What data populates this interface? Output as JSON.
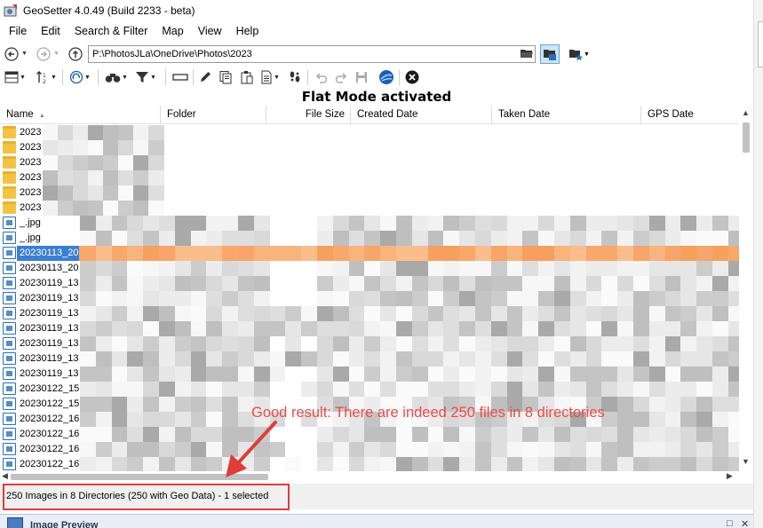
{
  "window": {
    "title": "GeoSetter 4.0.49 (Build 2233 - beta)"
  },
  "menu": [
    "File",
    "Edit",
    "Search & Filter",
    "Map",
    "View",
    "Help"
  ],
  "address": {
    "path": "P:\\PhotosJLa\\OneDrive\\Photos\\2023"
  },
  "banner": "Flat Mode activated",
  "columns": [
    {
      "label": "Name",
      "sort": "ascending"
    },
    {
      "label": "Folder"
    },
    {
      "label": "File Size"
    },
    {
      "label": "Created Date"
    },
    {
      "label": "Taken Date"
    },
    {
      "label": "GPS Date"
    }
  ],
  "rows": [
    {
      "type": "folder",
      "name": "2023"
    },
    {
      "type": "folder",
      "name": "2023"
    },
    {
      "type": "folder",
      "name": "2023"
    },
    {
      "type": "folder",
      "name": "2023"
    },
    {
      "type": "folder",
      "name": "2023"
    },
    {
      "type": "folder",
      "name": "2023"
    },
    {
      "type": "file",
      "name": "_.jpg"
    },
    {
      "type": "file",
      "name": "_.jpg"
    },
    {
      "type": "file",
      "name": "20230113_20",
      "selected": true
    },
    {
      "type": "file",
      "name": "20230113_20"
    },
    {
      "type": "file",
      "name": "20230119_13"
    },
    {
      "type": "file",
      "name": "20230119_13"
    },
    {
      "type": "file",
      "name": "20230119_13"
    },
    {
      "type": "file",
      "name": "20230119_13"
    },
    {
      "type": "file",
      "name": "20230119_13"
    },
    {
      "type": "file",
      "name": "20230119_13"
    },
    {
      "type": "file",
      "name": "20230119_13"
    },
    {
      "type": "file",
      "name": "20230122_15"
    },
    {
      "type": "file",
      "name": "20230122_15"
    },
    {
      "type": "file",
      "name": "20230122_16"
    },
    {
      "type": "file",
      "name": "20230122_16"
    },
    {
      "type": "file",
      "name": "20230122_16"
    },
    {
      "type": "file",
      "name": "20230122_16"
    }
  ],
  "status": {
    "text": "250 Images in 8 Directories (250 with Geo Data) - 1 selected"
  },
  "preview": {
    "title": "Image Preview"
  },
  "annotation": {
    "text": "Good result: There are indeed 250 files in 8 directories",
    "color": "#ec4a4a"
  },
  "colors": {
    "selection_blue": "#3a7fd2",
    "selection_orange": "#f8a86a",
    "annotation_red": "#e03c3c"
  },
  "icons": {
    "toolbar": [
      "columns-icon",
      "sort-icon",
      "refresh-icon",
      "binoculars-icon",
      "filter-icon",
      "rename-icon",
      "edit-icon",
      "copy-icon",
      "paste-icon",
      "footprints-icon",
      "undo-icon",
      "redo-icon",
      "save-icon",
      "globe-icon",
      "close-circle-icon"
    ]
  }
}
